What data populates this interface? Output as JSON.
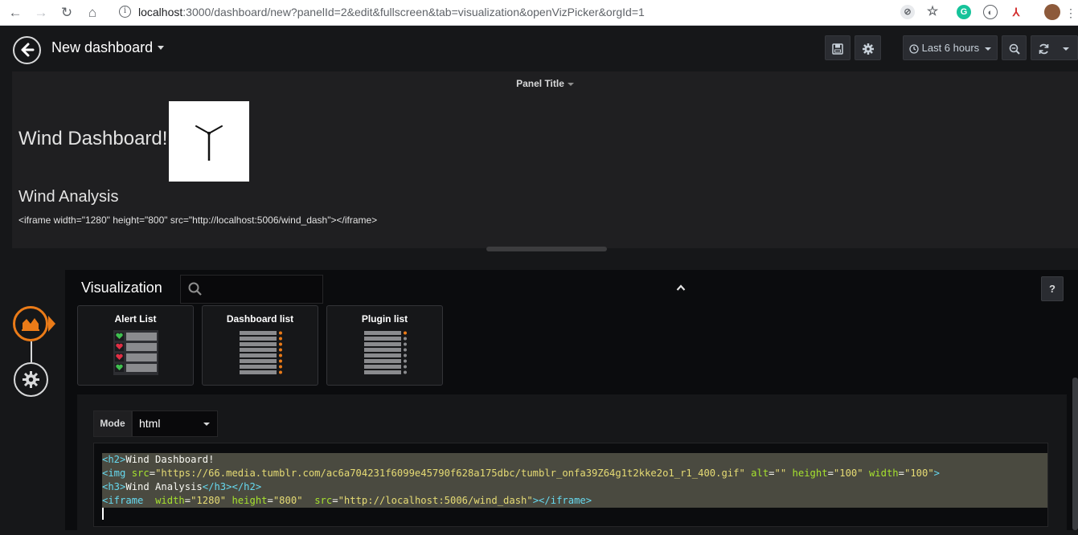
{
  "browser": {
    "url_host": "localhost",
    "url_rest": ":3000/dashboard/new?panelId=2&edit&fullscreen&tab=visualization&openVizPicker&orgId=1"
  },
  "nav": {
    "dashboard_title": "New dashboard",
    "time_range": "Last 6 hours"
  },
  "panel": {
    "title": "Panel Title",
    "heading": "Wind Dashboard!",
    "subheading": "Wind Analysis",
    "iframe_text": "<iframe width=\"1280\" height=\"800\" src=\"http://localhost:5006/wind_dash\"></iframe>"
  },
  "editor": {
    "header": "Visualization",
    "help": "?",
    "plugins": [
      {
        "label": "Alert List"
      },
      {
        "label": "Dashboard list"
      },
      {
        "label": "Plugin list"
      }
    ],
    "mode_label": "Mode",
    "mode_value": "html",
    "code": {
      "l1_tag": "h2",
      "l1_text": "Wind Dashboard!",
      "l2_tag": "img",
      "l2_src_attr": "src",
      "l2_src": "\"https://66.media.tumblr.com/ac6a704231f6099e45790f628a175dbc/tumblr_onfa39Z64g1t2kke2o1_r1_400.gif\"",
      "l2_alt_attr": "alt",
      "l2_alt": "\"\"",
      "l2_h_attr": "height",
      "l2_h": "\"100\"",
      "l2_w_attr": "width",
      "l2_w": "\"100\"",
      "l3_tag": "h3",
      "l3_text": "Wind Analysis",
      "l3_close1": "h3",
      "l3_close2": "h2",
      "l4_tag": "iframe",
      "l4_w_attr": "width",
      "l4_w": "\"1280\"",
      "l4_h_attr": "height",
      "l4_h": "\"800\"",
      "l4_src_attr": "src",
      "l4_src": "\"http://localhost:5006/wind_dash\"",
      "l4_close": "iframe"
    }
  }
}
